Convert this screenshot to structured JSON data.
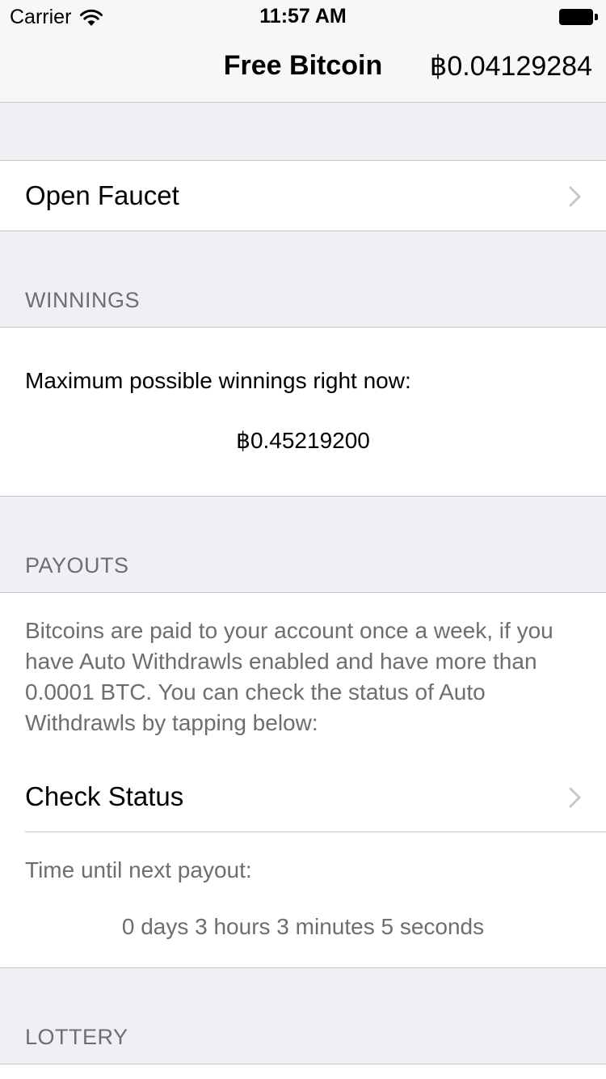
{
  "status_bar": {
    "carrier": "Carrier",
    "time": "11:57 AM"
  },
  "nav": {
    "title": "Free Bitcoin",
    "balance": "฿0.04129284"
  },
  "faucet": {
    "label": "Open Faucet"
  },
  "winnings": {
    "header": "WINNINGS",
    "label": "Maximum possible winnings right now:",
    "value": "฿0.45219200"
  },
  "payouts": {
    "header": "PAYOUTS",
    "description_lines": [
      "Bitcoins are paid to your account once a week, if you",
      "have Auto Withdrawls enabled and have more than",
      "0.0001 BTC. You can check the status of Auto",
      "Withdrawls by tapping below:"
    ],
    "check_status_label": "Check Status",
    "next_payout_label": "Time until next payout:",
    "countdown": "0 days 3 hours 3 minutes 5 seconds"
  },
  "lottery": {
    "header": "LOTTERY"
  },
  "colors": {
    "background": "#efeff4",
    "separator": "#c8c7cc",
    "secondary_text": "#6d6d72",
    "chevron": "#c7c7cc"
  },
  "icons": {
    "wifi": "wifi-icon",
    "battery": "battery-icon",
    "chevron": "chevron-right-icon"
  }
}
